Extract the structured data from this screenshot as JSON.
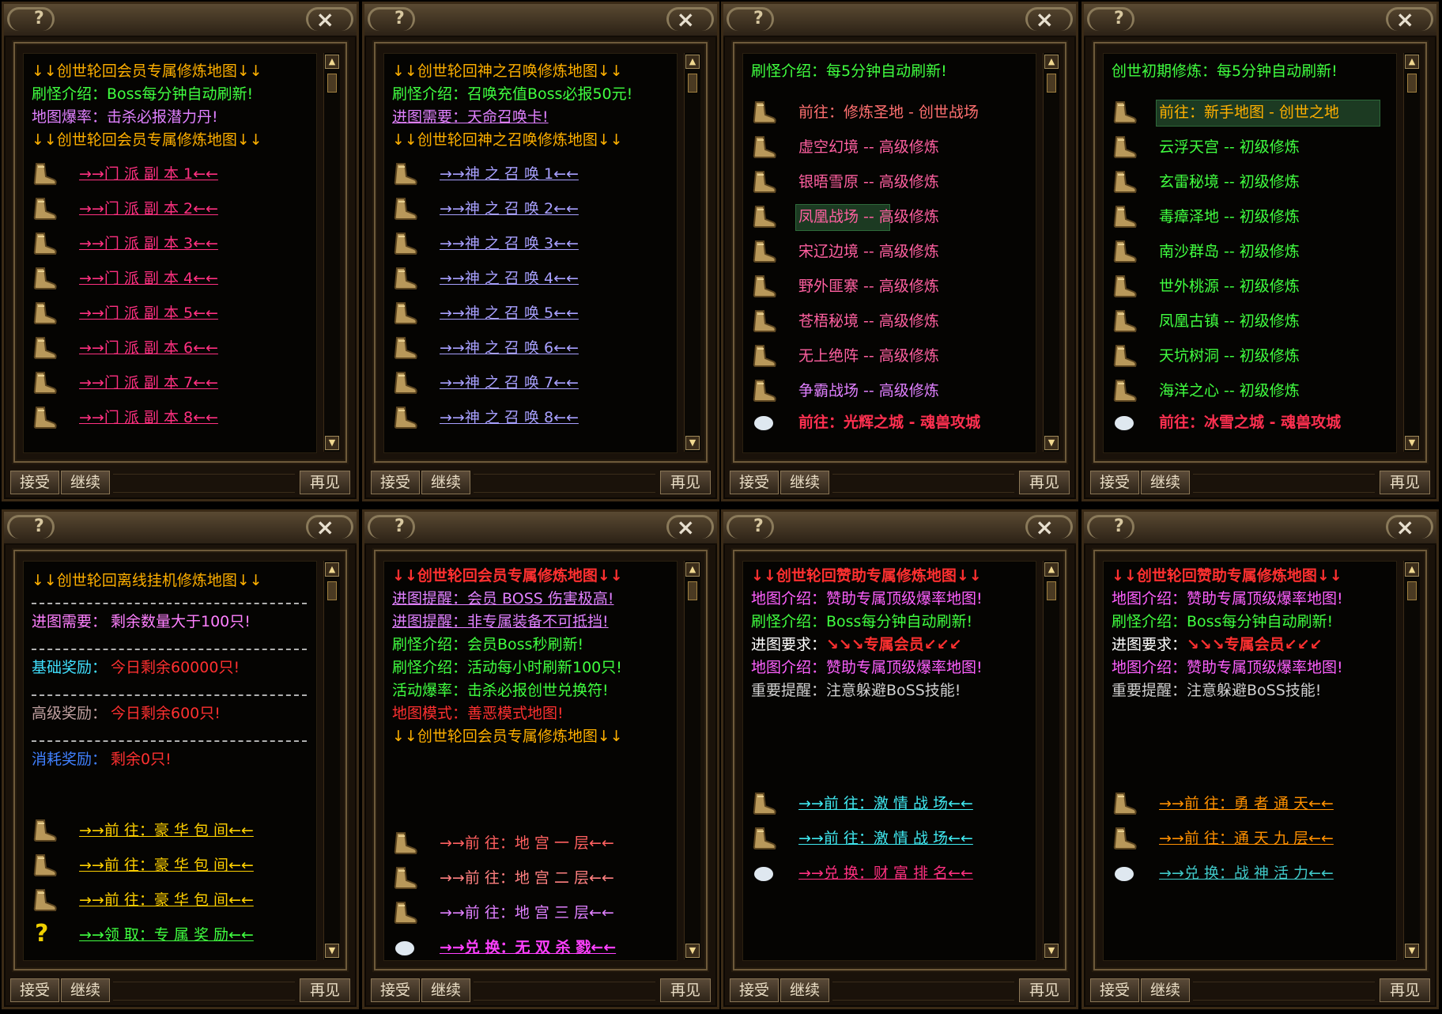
{
  "colors": {
    "bg": "#050402",
    "frame": "#6e5a3a",
    "gold": "#f0c000",
    "red": "#ff3030",
    "pink": "#ff60ff",
    "cyan": "#40e8f0",
    "green": "#40ff40",
    "yellow": "#ffd000"
  },
  "common": {
    "help": "?",
    "close": "×",
    "accept": "接受",
    "continue": "继续",
    "goodbye": "再见"
  },
  "panels": [
    {
      "lines": [
        {
          "t": "↓↓创世轮回会员专属修炼地图↓↓",
          "c": "#ffb000"
        },
        {
          "t": "刷怪介绍：Boss每分钟自动刷新!",
          "c": "#40ff40"
        },
        {
          "t": "地图爆率：击杀必报潜力丹!",
          "c": "#e080ff"
        },
        {
          "t": "↓↓创世轮回会员专属修炼地图↓↓",
          "c": "#ffb000"
        }
      ],
      "items": [
        {
          "t": "→→门 派 副 本 1←←",
          "c": "#ff3080"
        },
        {
          "t": "→→门 派 副 本 2←←",
          "c": "#ff3080"
        },
        {
          "t": "→→门 派 副 本 3←←",
          "c": "#ff3080"
        },
        {
          "t": "→→门 派 副 本 4←←",
          "c": "#ff3080"
        },
        {
          "t": "→→门 派 副 本 5←←",
          "c": "#ff3080"
        },
        {
          "t": "→→门 派 副 本 6←←",
          "c": "#ff3080"
        },
        {
          "t": "→→门 派 副 本 7←←",
          "c": "#ff3080"
        },
        {
          "t": "→→门 派 副 本 8←←",
          "c": "#ff3080"
        }
      ]
    },
    {
      "lines": [
        {
          "t": "↓↓创世轮回神之召唤修炼地图↓↓",
          "c": "#ffb000"
        },
        {
          "t": "刷怪介绍：召唤充值Boss必报50元!",
          "c": "#40ff40"
        },
        {
          "t": "进图需要：天命召唤卡!",
          "c": "#e080ff"
        },
        {
          "t": "↓↓创世轮回神之召唤修炼地图↓↓",
          "c": "#ffb000"
        }
      ],
      "items": [
        {
          "t": "→→神 之 召 唤 1←←",
          "c": "#a8a0ff"
        },
        {
          "t": "→→神 之 召 唤 2←←",
          "c": "#a8a0ff"
        },
        {
          "t": "→→神 之 召 唤 3←←",
          "c": "#a8a0ff"
        },
        {
          "t": "→→神 之 召 唤 4←←",
          "c": "#a8a0ff"
        },
        {
          "t": "→→神 之 召 唤 5←←",
          "c": "#a8a0ff"
        },
        {
          "t": "→→神 之 召 唤 6←←",
          "c": "#a8a0ff"
        },
        {
          "t": "→→神 之 召 唤 7←←",
          "c": "#a8a0ff"
        },
        {
          "t": "→→神 之 召 唤 8←←",
          "c": "#a8a0ff"
        }
      ]
    },
    {
      "header": {
        "t": "刷怪介绍：每5分钟自动刷新!",
        "c": "#40ff40"
      },
      "items": [
        {
          "t": "前往：修炼圣地 - 创世战场",
          "c": "#ff7070"
        },
        {
          "t": "虚空幻境 -- 高级修炼",
          "c": "#ff60a0"
        },
        {
          "t": "银晤雪原 -- 高级修炼",
          "c": "#ff60a0"
        },
        {
          "t": "凤凰战场 -- 高级修炼",
          "c": "#ff60a0"
        },
        {
          "t": "宋辽边境 -- 高级修炼",
          "c": "#ff60a0"
        },
        {
          "t": "野外匪寨 -- 高级修炼",
          "c": "#ff60a0"
        },
        {
          "t": "苍梧秘境 -- 高级修炼",
          "c": "#ff60a0"
        },
        {
          "t": "无上绝阵 -- 高级修炼",
          "c": "#ff60a0"
        },
        {
          "t": "争霸战场 -- 高级修炼",
          "c": "#e080ff"
        }
      ],
      "last": {
        "t": "前往：光辉之城 - 魂兽攻城",
        "c": "#ff3050"
      }
    },
    {
      "header": {
        "t": "创世初期修炼：每5分钟自动刷新!",
        "c": "#40ff40"
      },
      "items": [
        {
          "t": "前往：新手地图 - 创世之地",
          "c": "#ffb000"
        },
        {
          "t": "云浮天宫 -- 初级修炼",
          "c": "#40ff40"
        },
        {
          "t": "玄雷秘境 -- 初级修炼",
          "c": "#40ff40"
        },
        {
          "t": "毒瘴泽地 -- 初级修炼",
          "c": "#40ff40"
        },
        {
          "t": "南沙群岛 -- 初级修炼",
          "c": "#40ff40"
        },
        {
          "t": "世外桃源 -- 初级修炼",
          "c": "#40ff40"
        },
        {
          "t": "凤凰古镇 -- 初级修炼",
          "c": "#40ff40"
        },
        {
          "t": "天坑树洞 -- 初级修炼",
          "c": "#40ff40"
        },
        {
          "t": "海洋之心 -- 初级修炼",
          "c": "#40ff40"
        }
      ],
      "last": {
        "t": "前往：冰雪之城 - 魂兽攻城",
        "c": "#ff3050"
      }
    },
    {
      "title": {
        "t": "↓↓创世轮回离线挂机修炼地图↓↓",
        "c": "#ffb000"
      },
      "rows": [
        {
          "k": "进图需要：",
          "v": "剩余数量大于100只!",
          "kc": "#ff80ff",
          "vc": "#ff80ff"
        },
        {
          "k": "基础奖励：",
          "v": "今日剩余60000只!",
          "kc": "#40e0ff",
          "vc": "#ff3030"
        },
        {
          "k": "高级奖励：",
          "v": "今日剩余600只!",
          "kc": "#c0a0a0",
          "vc": "#ff3030"
        },
        {
          "k": "消耗奖励：",
          "v": "剩余0只!",
          "kc": "#4080ff",
          "vc": "#ff3030"
        }
      ],
      "items": [
        {
          "t": "→→前 往：豪 华 包 间←←",
          "c": "#ffd000"
        },
        {
          "t": "→→前 往：豪 华 包 间←←",
          "c": "#ffd000"
        },
        {
          "t": "→→前 往：豪 华 包 间←←",
          "c": "#ffd000"
        }
      ],
      "last": {
        "t": "→→领 取：专 属 奖 励←←",
        "c": "#40ff40"
      }
    },
    {
      "lines": [
        {
          "t": "↓↓创世轮回会员专属修炼地图↓↓",
          "c": "#ff3030",
          "b": true
        },
        {
          "t": "进图提醒：会员 BOSS 伤害极高!",
          "c": "#e080ff",
          "u": true
        },
        {
          "t": "进图提醒：非专属装备不可抵挡!",
          "c": "#e080ff",
          "u": true
        },
        {
          "t": "刷怪介绍：会员Boss秒刷新!",
          "c": "#40ff40"
        },
        {
          "t": "刷怪介绍：活动每小时刷新100只!",
          "c": "#40ff40"
        },
        {
          "t": "活动爆率：击杀必报创世兑换符!",
          "c": "#40ff40"
        },
        {
          "t": "地图模式：善恶模式地图!",
          "c": "#ff3030"
        },
        {
          "t": "↓↓创世轮回会员专属修炼地图↓↓",
          "c": "#ffb000"
        }
      ],
      "items": [
        {
          "t": "→→前 往：地 宫 一 层←←",
          "c": "#ff6060"
        },
        {
          "t": "→→前 往：地 宫 二 层←←",
          "c": "#ff8080"
        },
        {
          "t": "→→前 往：地 宫 三 层←←",
          "c": "#e080ff"
        }
      ],
      "last": {
        "t": "→→兑 换：无 双 杀 戮←←",
        "c": "#ff40ff"
      }
    },
    {
      "lines": [
        {
          "t": "↓↓创世轮回赞助专属修炼地图↓↓",
          "c": "#ff3030",
          "b": true
        },
        {
          "t": "地图介绍：赞助专属顶级爆率地图!",
          "c": "#ff60ff"
        },
        {
          "t": "刷怪介绍：Boss每分钟自动刷新!",
          "c": "#40ff40"
        },
        {
          "t": "进图要求：↘↘↘专属会员↙↙↙",
          "c": "#ffffff",
          "hot": true
        },
        {
          "t": "地图介绍：赞助专属顶级爆率地图!",
          "c": "#ff60ff"
        },
        {
          "t": "重要提醒：注意躲避BoSS技能!",
          "c": "#d0d0d0"
        }
      ],
      "items": [
        {
          "t": "→→前 往：激 情 战 场←←",
          "c": "#40e8f0"
        },
        {
          "t": "→→前 往：激 情 战 场←←",
          "c": "#40e8f0"
        }
      ],
      "last": {
        "t": "→→兑 换：财 富 排 名←←",
        "c": "#ff3080"
      }
    },
    {
      "lines": [
        {
          "t": "↓↓创世轮回赞助专属修炼地图↓↓",
          "c": "#ff3030",
          "b": true
        },
        {
          "t": "地图介绍：赞助专属顶级爆率地图!",
          "c": "#ff60ff"
        },
        {
          "t": "刷怪介绍：Boss每分钟自动刷新!",
          "c": "#40ff40"
        },
        {
          "t": "进图要求：↘↘↘专属会员↙↙↙",
          "c": "#ffffff",
          "hot": true
        },
        {
          "t": "地图介绍：赞助专属顶级爆率地图!",
          "c": "#ff60ff"
        },
        {
          "t": "重要提醒：注意躲避BoSS技能!",
          "c": "#d0d0d0"
        }
      ],
      "items": [
        {
          "t": "→→前 往：勇 者 通 天←←",
          "c": "#ff9000"
        },
        {
          "t": "→→前 往：通 天 九 层←←",
          "c": "#ff9000"
        }
      ],
      "last": {
        "t": "→→兑 换：战 神 活 力←←",
        "c": "#40c8c8"
      }
    }
  ]
}
